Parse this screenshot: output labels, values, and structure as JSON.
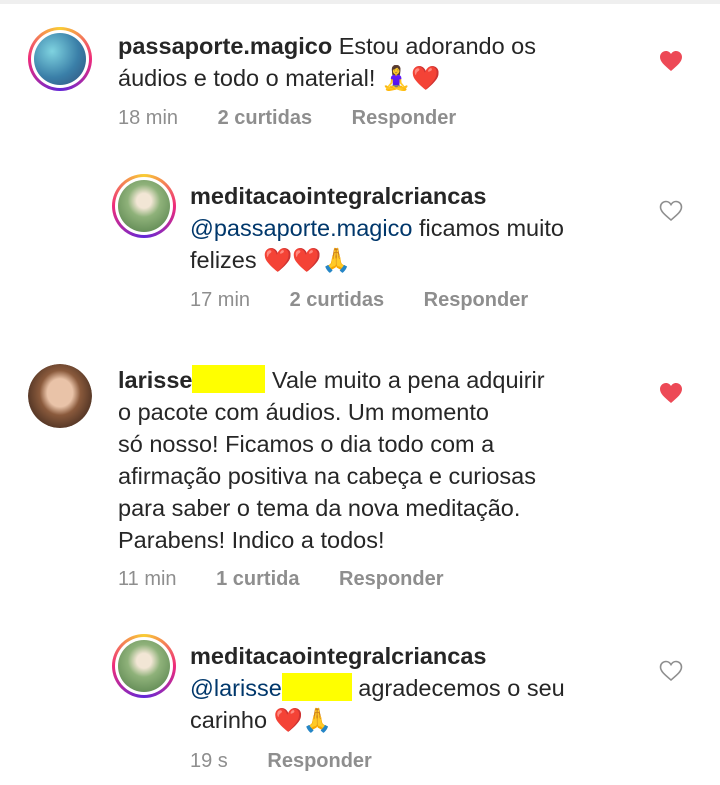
{
  "comments": [
    {
      "username": "passaporte.magico",
      "text_line1": "Estou adorando os",
      "text_line2": "áudios e todo o material! 🧘‍♀️❤️",
      "time": "18 min",
      "likes": "2 curtidas",
      "reply": "Responder",
      "liked": true
    },
    {
      "username": "meditacaointegralcriancas",
      "mention": "@passaporte.magico",
      "text_line1": "ficamos muito",
      "text_line2": "felizes ❤️❤️🙏",
      "time": "17 min",
      "likes": "2 curtidas",
      "reply": "Responder",
      "liked": false
    },
    {
      "username": "larisse",
      "text_line1": "Vale muito a pena adquirir",
      "text_line2": "o pacote com áudios. Um momento",
      "text_line3": "só nosso! Ficamos o dia todo com a",
      "text_line4": "afirmação positiva na cabeça e curiosas",
      "text_line5": "para saber o tema da nova meditação.",
      "text_line6": "Parabens!  Indico a todos!",
      "time": "11 min",
      "likes": "1 curtida",
      "reply": "Responder",
      "liked": true
    },
    {
      "username": "meditacaointegralcriancas",
      "mention": "@larisse",
      "text_line1": "agradecemos o seu",
      "text_line2": "carinho ❤️🙏",
      "time": "19 s",
      "reply": "Responder",
      "liked": false
    }
  ],
  "colors": {
    "liked_heart": "#ed4956",
    "redaction": "#ffff00",
    "mention": "#00376b",
    "meta": "#8e8e8e"
  }
}
